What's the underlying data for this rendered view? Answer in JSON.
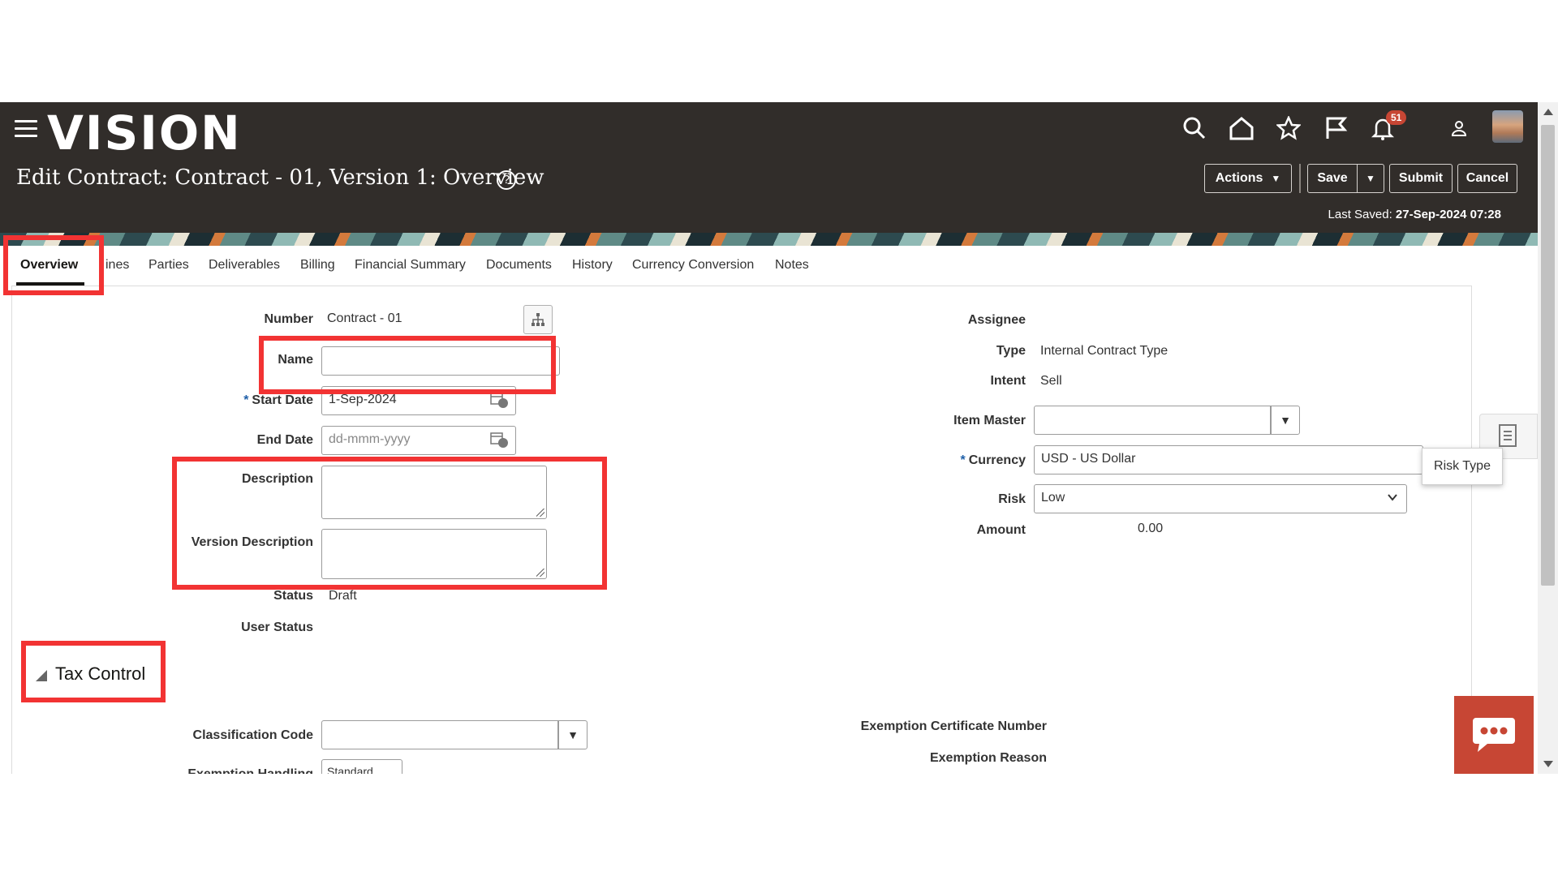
{
  "header": {
    "logo": "VISION",
    "notification_count": "51",
    "title": "Edit Contract: Contract - 01, Version 1: Overview",
    "buttons": {
      "actions": "Actions",
      "save": "Save",
      "submit": "Submit",
      "cancel": "Cancel"
    },
    "last_saved_label": "Last Saved:",
    "last_saved_value": "27-Sep-2024 07:28"
  },
  "tabs": [
    "Overview",
    "Lines",
    "Parties",
    "Deliverables",
    "Billing",
    "Financial Summary",
    "Documents",
    "History",
    "Currency Conversion",
    "Notes"
  ],
  "tabs_display": {
    "lines_clipped": "ines"
  },
  "left": {
    "number_label": "Number",
    "number_value": "Contract - 01",
    "name_label": "Name",
    "name_value": "",
    "start_date_label": "Start Date",
    "start_date_value": "1-Sep-2024",
    "end_date_label": "End Date",
    "end_date_placeholder": "dd-mmm-yyyy",
    "description_label": "Description",
    "version_description_label": "Version Description",
    "status_label": "Status",
    "status_value": "Draft",
    "user_status_label": "User Status",
    "required_mark": "*"
  },
  "right": {
    "assignee_label": "Assignee",
    "type_label": "Type",
    "type_value": "Internal Contract Type",
    "intent_label": "Intent",
    "intent_value": "Sell",
    "item_master_label": "Item Master",
    "currency_label": "Currency",
    "currency_value": "USD - US Dollar",
    "risk_label": "Risk",
    "risk_value": "Low",
    "amount_label": "Amount",
    "amount_value": "0.00",
    "tooltip": "Risk Type"
  },
  "tax_control": {
    "title": "Tax Control",
    "classification_code_label": "Classification Code",
    "exemption_handling_label": "Exemption Handling",
    "exemption_handling_value": "Standard",
    "exemption_certificate_label": "Exemption Certificate Number",
    "exemption_reason_label": "Exemption Reason"
  },
  "colors": {
    "header_bg": "#312d2a",
    "highlight": "#f23333",
    "chat_button": "#c74634",
    "badge": "#c74634"
  },
  "icons": [
    "hamburger-icon",
    "search-icon",
    "home-icon",
    "star-icon",
    "flag-icon",
    "bell-icon",
    "user-icon",
    "help-icon",
    "hierarchy-icon",
    "calendar-icon",
    "chevron-down-icon",
    "document-icon",
    "chat-icon"
  ]
}
